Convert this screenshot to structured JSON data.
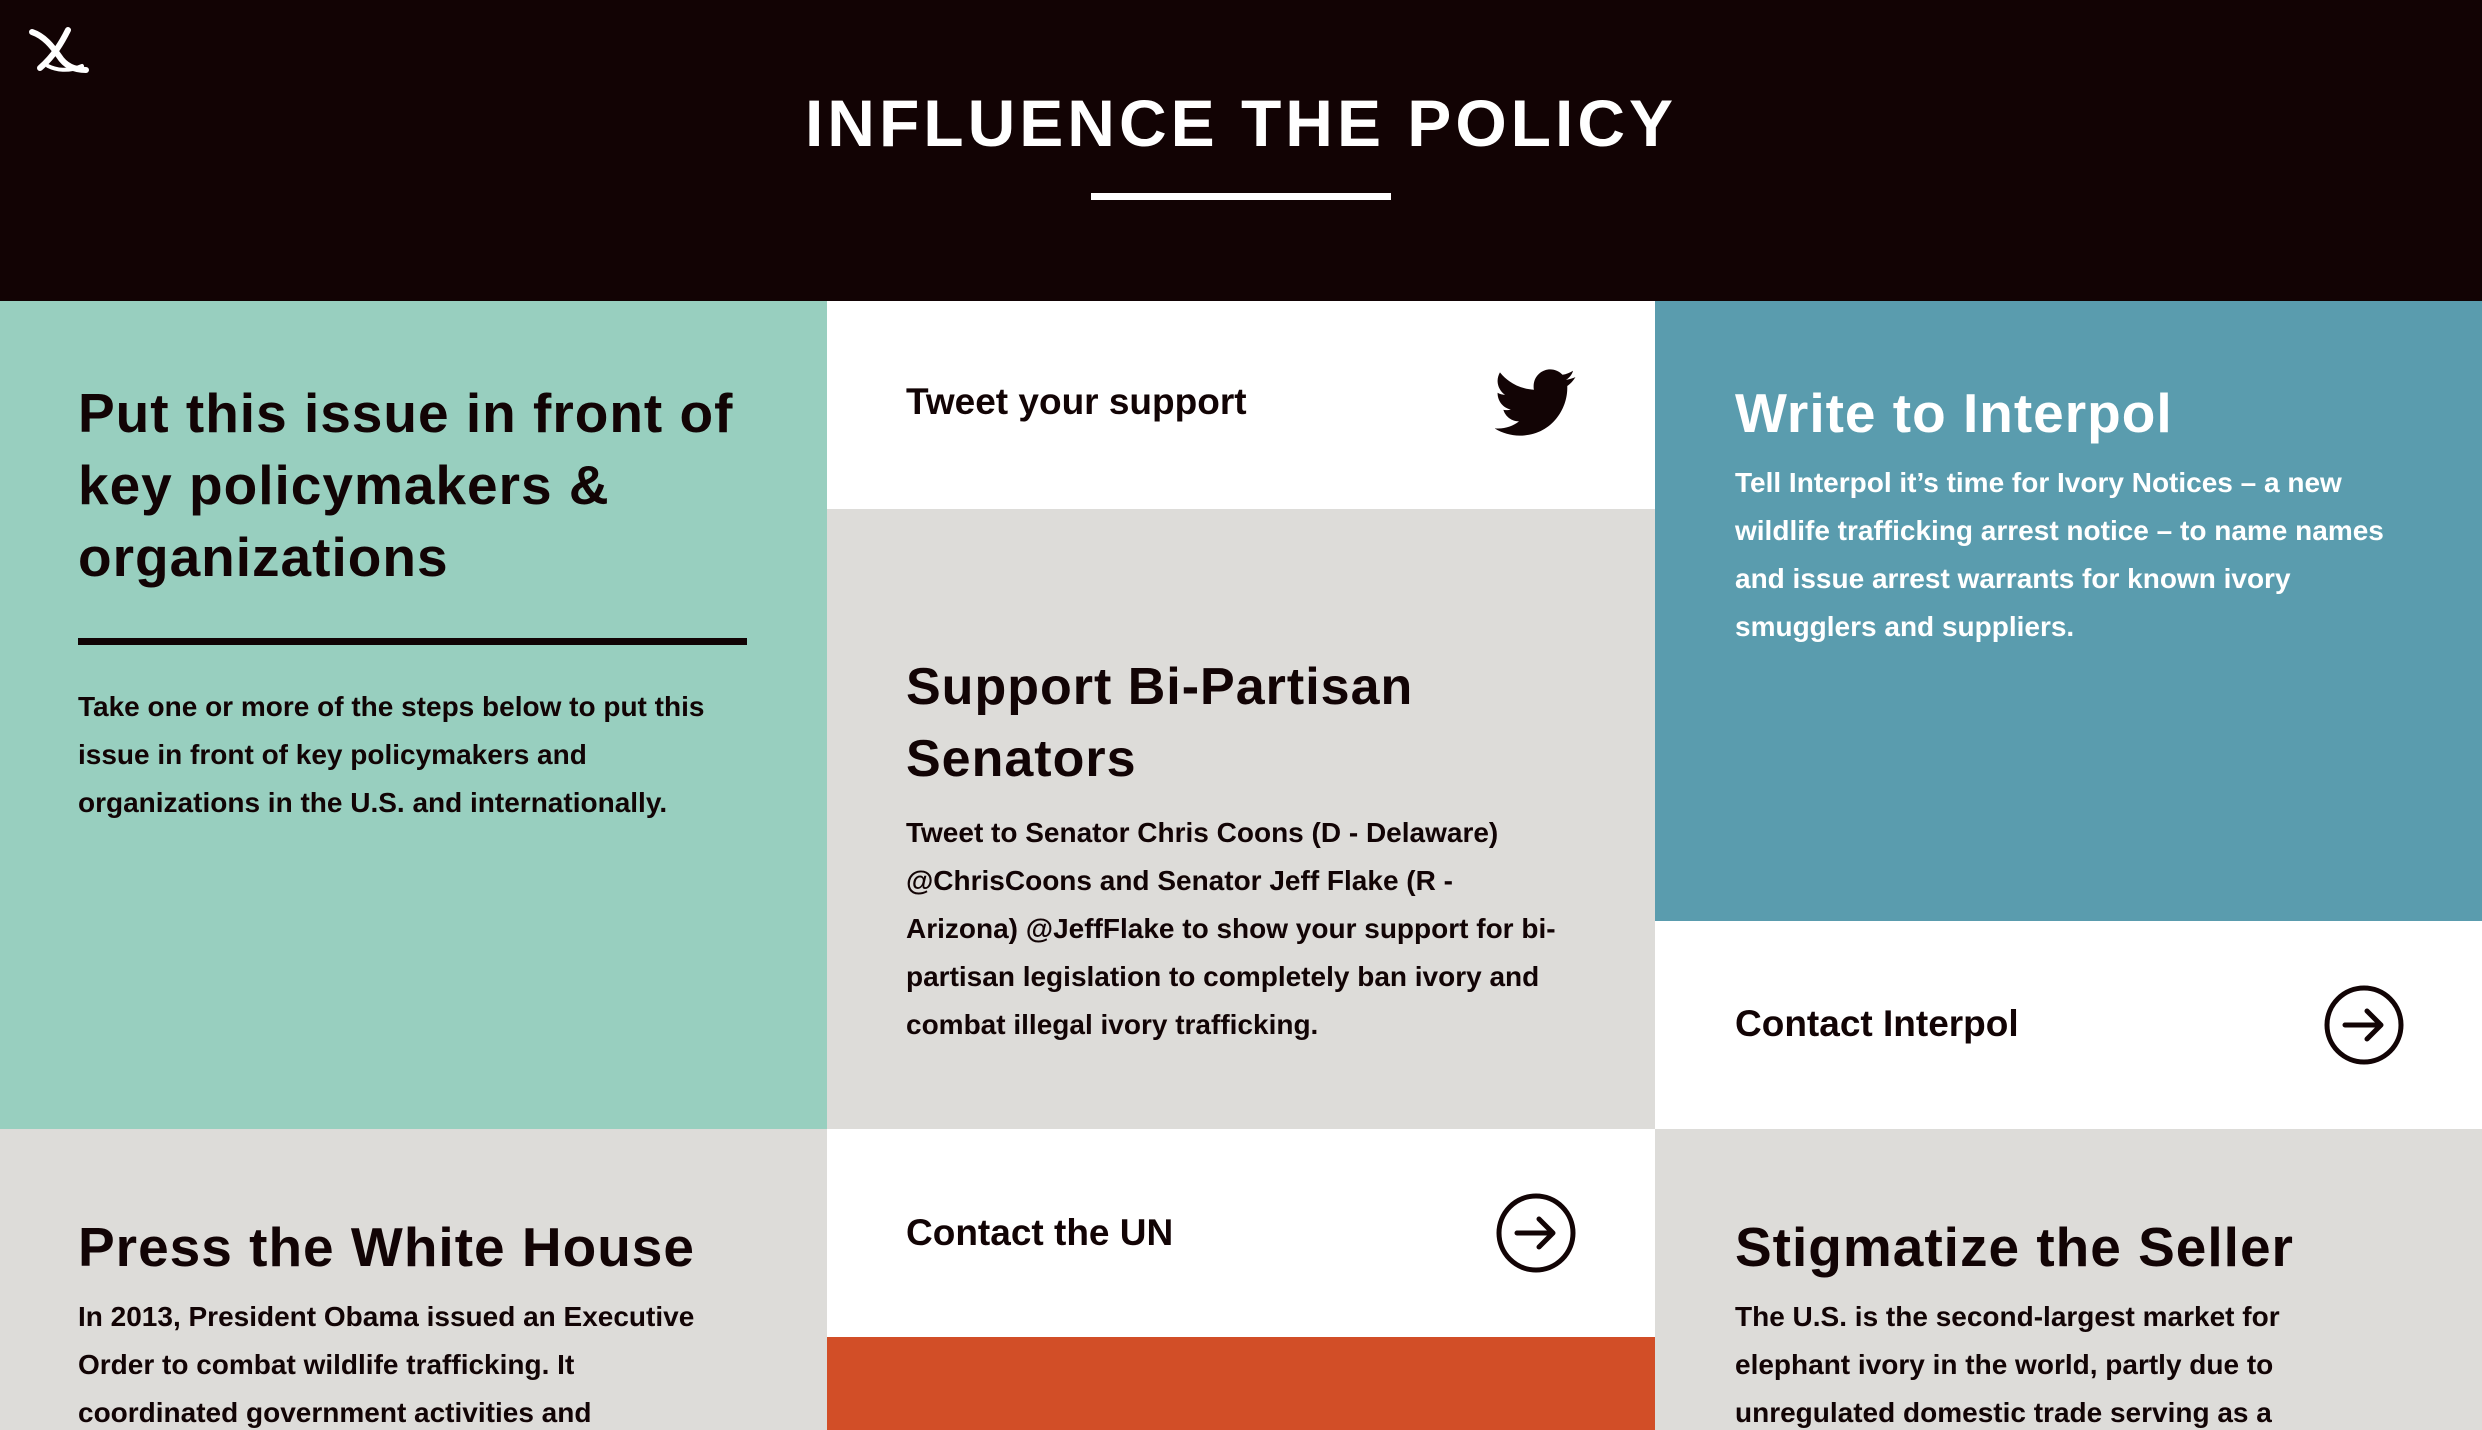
{
  "header": {
    "title": "INFLUENCE THE POLICY",
    "logo_icon": "x-logo-icon",
    "background": "#120304"
  },
  "colors": {
    "teal": "#98cfbf",
    "grey": "#dddcd9",
    "blue": "#5a9cae",
    "white": "#ffffff",
    "orange": "#d24e27",
    "dark": "#120405"
  },
  "intro": {
    "heading": "Put this issue in front of key policymakers & organizations",
    "body": "Take one or more of the steps below to put this issue in front of key policymakers and organizations in the U.S. and internationally."
  },
  "tweet": {
    "label": "Tweet your support",
    "icon": "twitter-bird-icon"
  },
  "senators": {
    "heading": "Support Bi-Partisan Senators",
    "body": "Tweet to Senator Chris Coons (D - Delaware) @ChrisCoons and Senator Jeff Flake (R - Arizona) @JeffFlake to show your support for bi-partisan legislation to completely ban ivory and combat illegal ivory trafficking."
  },
  "interpol": {
    "heading": "Write to Interpol",
    "body": "Tell Interpol it’s time for Ivory Notices – a new wildlife trafficking arrest notice – to name names and issue arrest warrants for known ivory smugglers and suppliers.",
    "action_label": "Contact Interpol",
    "action_icon": "circle-arrow-right-icon"
  },
  "white_house": {
    "heading": "Press the White House",
    "body": "In 2013, President Obama issued an Executive Order to combat wildlife trafficking. It coordinated government activities and"
  },
  "un": {
    "action_label": "Contact the UN",
    "action_icon": "circle-arrow-right-icon"
  },
  "seller": {
    "heading": "Stigmatize the Seller",
    "body": "The U.S. is the second-largest market for elephant ivory in the world, partly due to unregulated domestic trade serving as a"
  }
}
